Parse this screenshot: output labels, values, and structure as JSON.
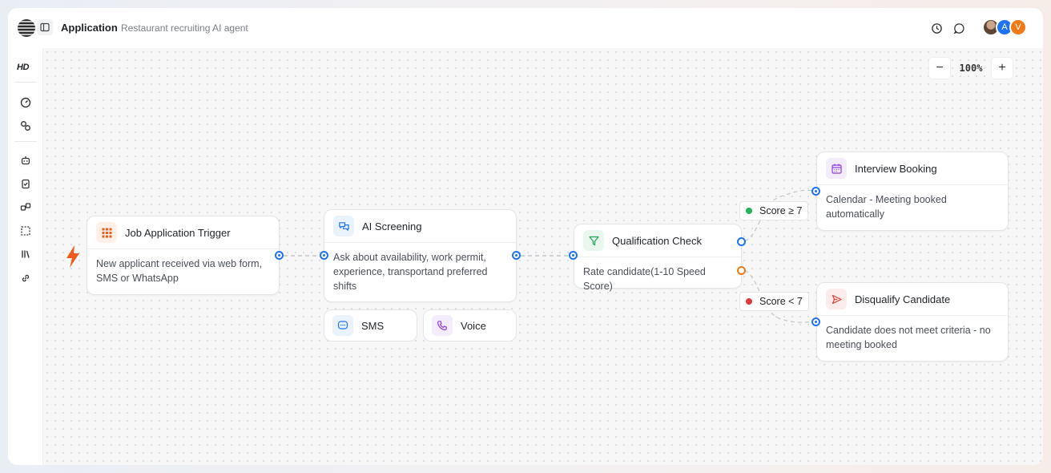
{
  "header": {
    "title": "Application",
    "subtitle": "Restaurant recruiting AI agent",
    "icons": [
      "history-icon",
      "comment-icon"
    ],
    "avatars": [
      {
        "type": "photo"
      },
      {
        "initial": "A",
        "color": "#1d73f2"
      },
      {
        "initial": "V",
        "color": "#f07a1a"
      }
    ]
  },
  "sidebar": {
    "logo": "HD",
    "items": [
      "dashboard-icon",
      "integrations-icon",
      "agent-icon",
      "tasks-icon",
      "workflow-icon",
      "select-icon",
      "library-icon",
      "link-icon"
    ]
  },
  "zoom": {
    "minus": "−",
    "level": "100%",
    "plus": "+"
  },
  "nodes": {
    "trigger": {
      "title": "Job Application Trigger",
      "body": "New applicant received via web form, SMS or WhatsApp",
      "accent": "#f05a1a"
    },
    "screening": {
      "title": "AI Screening",
      "body": "Ask about availability, work permit, experience, transportand preferred shifts",
      "channels": [
        "SMS",
        "Voice"
      ]
    },
    "qualification": {
      "title": "Qualification Check",
      "body": "Rate candidate(1-10 Speed Score)"
    },
    "interview": {
      "title": "Interview Booking",
      "body": "Calendar - Meeting booked automatically"
    },
    "disqualify": {
      "title": "Disqualify Candidate",
      "body": "Candidate does not meet criteria - no meeting booked"
    }
  },
  "edges": {
    "pass_label": "Score ≥ 7",
    "fail_label": "Score < 7",
    "pass_color": "#22b35a",
    "fail_color": "#e53935"
  }
}
